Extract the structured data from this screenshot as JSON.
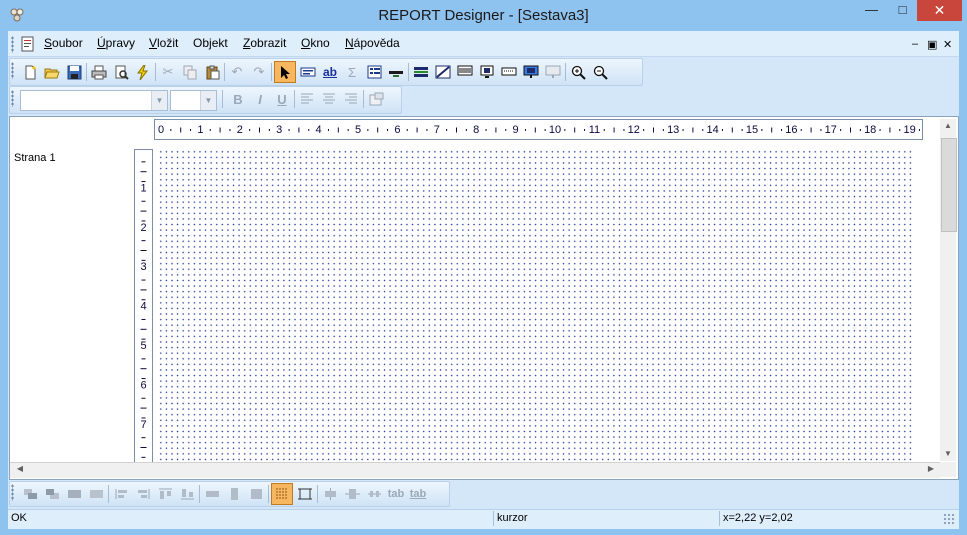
{
  "window": {
    "title": "REPORT Designer - [Sestava3]"
  },
  "caption_buttons": {
    "minimize": "—",
    "maximize": "□",
    "close": "✕"
  },
  "menu": {
    "items": [
      {
        "label": "Soubor",
        "underline_char": "S"
      },
      {
        "label": "Úpravy",
        "underline_char": "Ú"
      },
      {
        "label": "Vložit",
        "underline_char": "V"
      },
      {
        "label": "Objekt",
        "underline_char": "j"
      },
      {
        "label": "Zobrazit",
        "underline_char": "Z"
      },
      {
        "label": "Okno",
        "underline_char": "O"
      },
      {
        "label": "Nápověda",
        "underline_char": "N"
      }
    ],
    "mdi_controls": [
      "–",
      "▣",
      "✕"
    ]
  },
  "toolbar_main": {
    "buttons": [
      "new-icon",
      "open-icon",
      "save-icon",
      "print-icon",
      "print-preview-icon",
      "run-icon",
      "cut-icon",
      "copy-icon",
      "paste-icon",
      "undo-icon",
      "redo-icon",
      "select-pointer-icon",
      "insert-field-icon",
      "insert-text-icon",
      "insert-sum-icon",
      "insert-list-icon",
      "insert-line-icon",
      "band-icon",
      "band-detail-icon",
      "band-header-icon",
      "band-footer-icon",
      "band-group-icon",
      "band-page-icon",
      "band-summary-icon",
      "zoom-in-icon",
      "zoom-out-icon"
    ]
  },
  "toolbar_format": {
    "font_name": "",
    "font_size": "",
    "bold": "B",
    "italic": "I",
    "underline": "U"
  },
  "sections": {
    "page_label": "Strana 1"
  },
  "ruler": {
    "h_marks": [
      "0",
      "1",
      "2",
      "3",
      "4",
      "5",
      "6",
      "7",
      "8",
      "9",
      "10",
      "11",
      "12",
      "13",
      "14",
      "15",
      "16",
      "17",
      "18",
      "19"
    ],
    "v_marks": [
      "1",
      "2",
      "3",
      "4",
      "5",
      "6",
      "7"
    ]
  },
  "toolbar_bottom": {
    "tab_label": "tab"
  },
  "status": {
    "state": "OK",
    "tool": "kurzor",
    "coords": "x=2,22   y=2,02"
  },
  "colors": {
    "titlebar": "#8fc3ef",
    "close": "#c9463d",
    "grid_dot": "#2a3ea0"
  }
}
